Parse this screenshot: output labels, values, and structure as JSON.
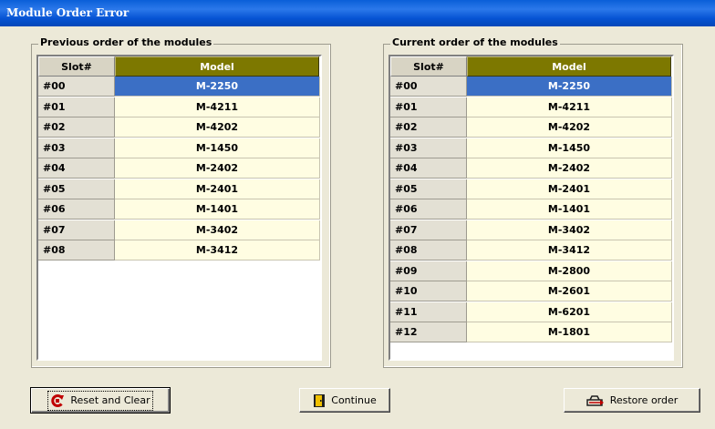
{
  "window": {
    "title": "Module Order Error"
  },
  "previous": {
    "label": "Previous order of the modules",
    "headers": {
      "slot": "Slot#",
      "model": "Model"
    },
    "selected_row": 0,
    "rows": [
      {
        "slot": "#00",
        "model": "M-2250"
      },
      {
        "slot": "#01",
        "model": "M-4211"
      },
      {
        "slot": "#02",
        "model": "M-4202"
      },
      {
        "slot": "#03",
        "model": "M-1450"
      },
      {
        "slot": "#04",
        "model": "M-2402"
      },
      {
        "slot": "#05",
        "model": "M-2401"
      },
      {
        "slot": "#06",
        "model": "M-1401"
      },
      {
        "slot": "#07",
        "model": "M-3402"
      },
      {
        "slot": "#08",
        "model": "M-3412"
      }
    ]
  },
  "current": {
    "label": "Current order of the modules",
    "headers": {
      "slot": "Slot#",
      "model": "Model"
    },
    "selected_row": 0,
    "rows": [
      {
        "slot": "#00",
        "model": "M-2250"
      },
      {
        "slot": "#01",
        "model": "M-4211"
      },
      {
        "slot": "#02",
        "model": "M-4202"
      },
      {
        "slot": "#03",
        "model": "M-1450"
      },
      {
        "slot": "#04",
        "model": "M-2402"
      },
      {
        "slot": "#05",
        "model": "M-2401"
      },
      {
        "slot": "#06",
        "model": "M-1401"
      },
      {
        "slot": "#07",
        "model": "M-3402"
      },
      {
        "slot": "#08",
        "model": "M-3412"
      },
      {
        "slot": "#09",
        "model": "M-2800"
      },
      {
        "slot": "#10",
        "model": "M-2601"
      },
      {
        "slot": "#11",
        "model": "M-6201"
      },
      {
        "slot": "#12",
        "model": "M-1801"
      }
    ]
  },
  "buttons": {
    "reset": {
      "label": "Reset and Clear",
      "icon": "reset-icon"
    },
    "continue": {
      "label": "Continue",
      "icon": "door-icon"
    },
    "restore": {
      "label": "Restore order",
      "icon": "restore-icon"
    }
  },
  "colors": {
    "title_bar": "#0a5fd8",
    "model_header": "#7d7800",
    "selected_row": "#3b6fc5",
    "model_cell": "#fffde2",
    "slot_cell": "#e3e0d4"
  }
}
